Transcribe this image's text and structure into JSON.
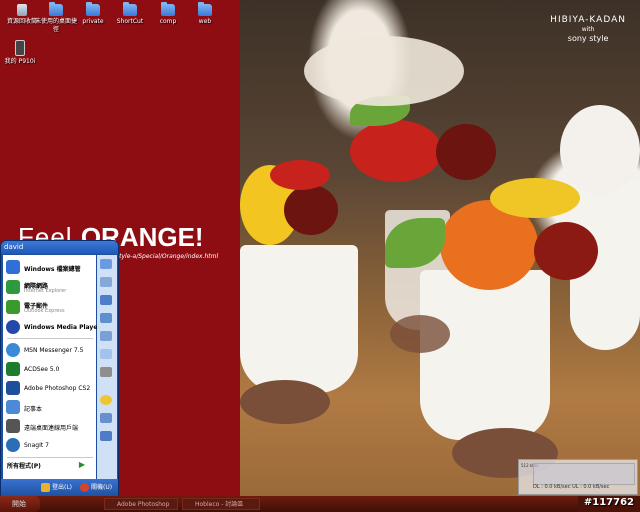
{
  "desktop": {
    "icons": [
      {
        "label": "資源回收筒",
        "kind": "bin"
      },
      {
        "label": "未使用的桌面捷徑",
        "kind": "folder"
      },
      {
        "label": "private",
        "kind": "folder"
      },
      {
        "label": "ShortCut",
        "kind": "folder"
      },
      {
        "label": "comp",
        "kind": "folder"
      },
      {
        "label": "web",
        "kind": "folder"
      },
      {
        "label": "我的 P910i",
        "kind": "phone"
      }
    ]
  },
  "wallpaper": {
    "brand_line1": "HIBIYA-KADAN",
    "brand_line2": "with",
    "brand_line3": "sony style",
    "slogan_thin": "Feel ",
    "slogan_bold": "ORANGE!",
    "url_fragment": "style-a/Special/Orange/index.html"
  },
  "start_menu": {
    "user": "david",
    "pinned": [
      {
        "title": "Windows 檔案總管",
        "subtitle": "",
        "icon": "explorer-icon",
        "color": "#2f6fd6"
      },
      {
        "title": "網際網路",
        "subtitle": "Internet Explorer",
        "icon": "internet-explorer-icon",
        "color": "#2d9a3e"
      },
      {
        "title": "電子郵件",
        "subtitle": "Outlook Express",
        "icon": "mail-icon",
        "color": "#3a9a2e"
      },
      {
        "title": "Windows Media Player",
        "subtitle": "",
        "icon": "media-player-icon",
        "color": "#2449a8"
      }
    ],
    "recent": [
      {
        "title": "MSN Messenger 7.5",
        "icon": "msn-icon",
        "color": "#3b8ad8"
      },
      {
        "title": "ACDSee 5.0",
        "icon": "acdsee-icon",
        "color": "#1e7d2c"
      },
      {
        "title": "Adobe Photoshop CS2",
        "icon": "photoshop-icon",
        "color": "#1c4f9c"
      },
      {
        "title": "記事本",
        "icon": "notepad-icon",
        "color": "#4c89d6"
      },
      {
        "title": "遠端桌面連線用戶端",
        "icon": "remote-desktop-icon",
        "color": "#555555"
      },
      {
        "title": "SnagIt 7",
        "icon": "snagit-icon",
        "color": "#2a6fb6"
      }
    ],
    "all_programs": "所有程式(P)",
    "right_icons": [
      "documents-icon",
      "pictures-icon",
      "music-icon",
      "computer-icon",
      "network-icon",
      "control-panel-icon",
      "printers-icon",
      "help-icon",
      "search-icon",
      "run-icon"
    ],
    "logoff": "登出(L)",
    "shutdown": "關機(U)"
  },
  "taskbar": {
    "start": "開始",
    "tasks": [
      "Adobe Photoshop",
      "Hobleco - 討論區"
    ]
  },
  "netmon": {
    "scale_top": "512 kB/s",
    "readout": "DL : 0.0 kB/sec   UL : 0.0 kB/sec"
  },
  "badge": "#117762"
}
